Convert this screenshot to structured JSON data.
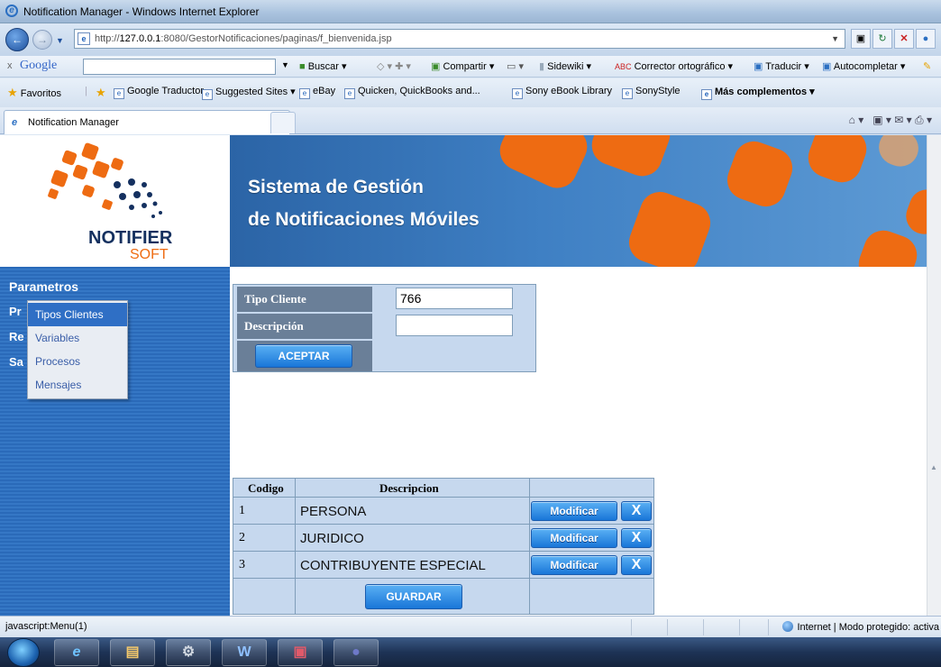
{
  "window": {
    "title": "Notification Manager - Windows Internet Explorer"
  },
  "address": {
    "url_prefix": "http://",
    "url_host": "127.0.0.1",
    "url_rest": ":8080/GestorNotificaciones/paginas/f_bienvenida.jsp"
  },
  "google_bar": {
    "close": "x",
    "logo": "Google",
    "buscar": "Buscar",
    "compartir": "Compartir",
    "sidewiki": "Sidewiki",
    "corrector": "Corrector ortográfico",
    "traducir": "Traducir",
    "autocompletar": "Autocompletar"
  },
  "favorites_bar": {
    "favoritos": "Favoritos",
    "items": [
      "Google Traductor",
      "Suggested Sites",
      "eBay",
      "Quicken, QuickBooks and...",
      "Sony eBook Library",
      "SonyStyle",
      "Más complementos"
    ]
  },
  "tab": {
    "title": "Notification Manager"
  },
  "header": {
    "logo_main": "NOTIFIER",
    "logo_sub": "SOFT",
    "banner_line1": "Sistema de Gestión",
    "banner_line2": "de Notificaciones Móviles"
  },
  "sidebar": {
    "heading": "Parametros",
    "hidden_items": [
      "Pr",
      "Re",
      "Sa"
    ],
    "dropdown": [
      "Tipos Clientes",
      "Variables",
      "Procesos",
      "Mensajes"
    ]
  },
  "form": {
    "tipo_label": "Tipo Cliente",
    "tipo_value": "766",
    "descripcion_label": "Descripción",
    "descripcion_value": "",
    "aceptar": "ACEPTAR"
  },
  "table": {
    "headers": {
      "codigo": "Codigo",
      "descripcion": "Descripcion"
    },
    "rows": [
      {
        "codigo": "1",
        "descripcion": "PERSONA"
      },
      {
        "codigo": "2",
        "descripcion": "JURIDICO"
      },
      {
        "codigo": "3",
        "descripcion": "CONTRIBUYENTE ESPECIAL"
      }
    ],
    "modify_label": "Modificar",
    "delete_label": "X",
    "guardar": "GUARDAR"
  },
  "status": {
    "left": "javascript:Menu(1)",
    "right": "Internet | Modo protegido: activa"
  },
  "colors": {
    "banner": "#3f80c4",
    "orange": "#ee6b12",
    "sidebar": "#2a6ab9",
    "panel": "#c6d8ee",
    "label": "#6a7f98"
  }
}
